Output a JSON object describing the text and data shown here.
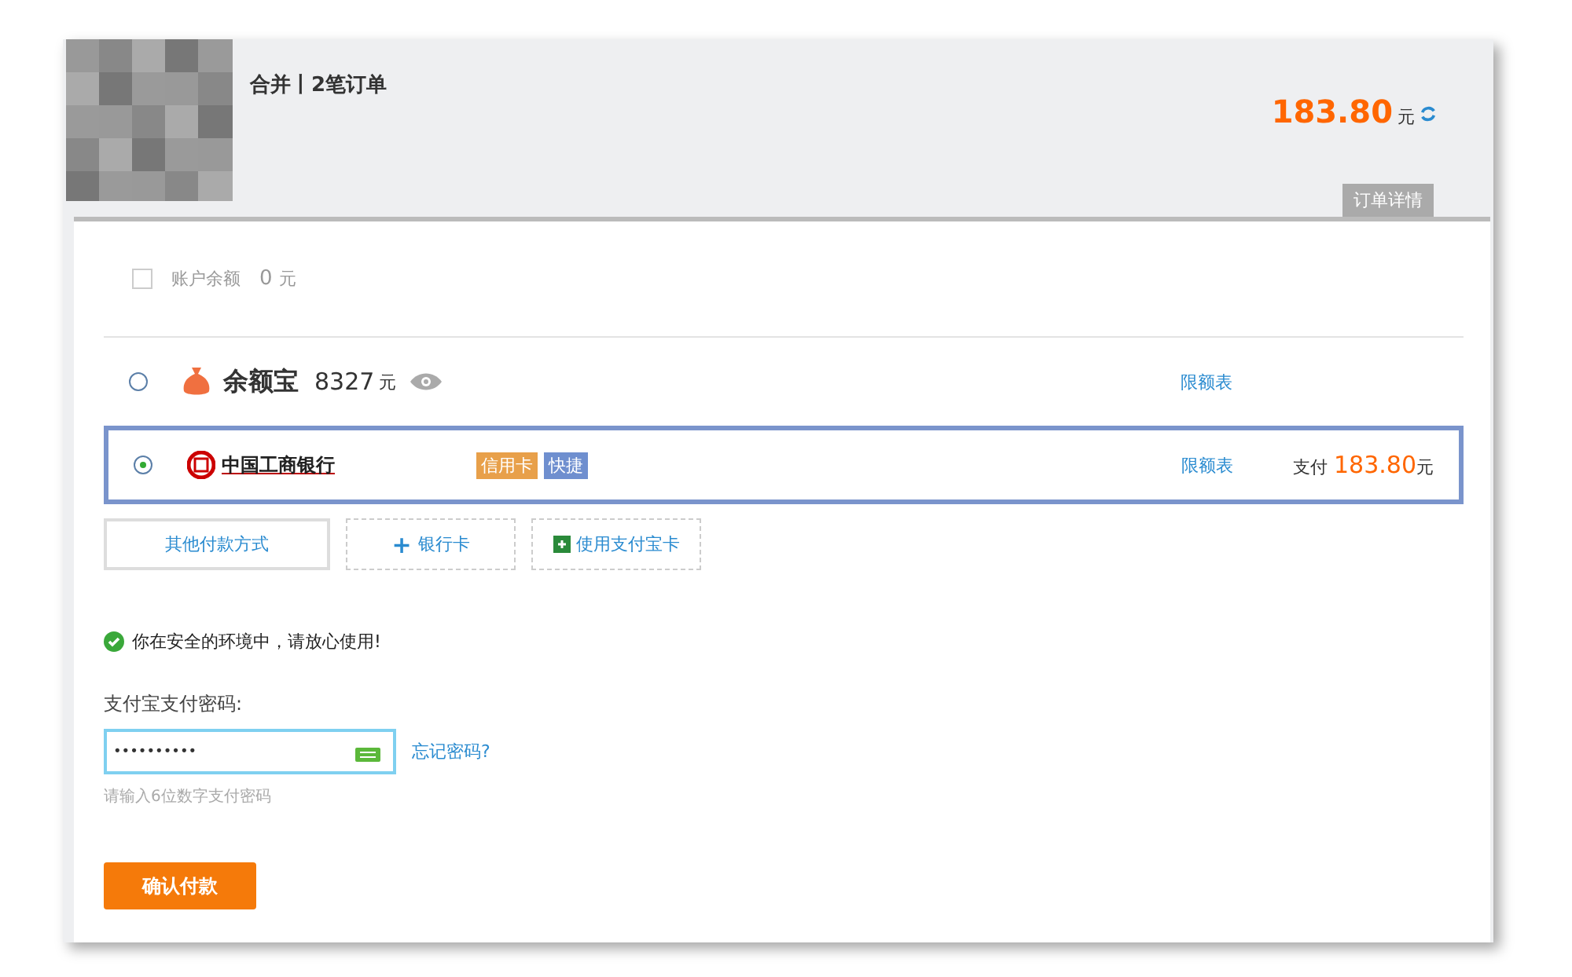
{
  "order": {
    "title": "合并丨2笔订单",
    "amount": "183.80",
    "unit": "元",
    "details_tab": "订单详情"
  },
  "balance": {
    "label": "账户余额",
    "amount": "0",
    "unit": "元",
    "checked": false
  },
  "methods": [
    {
      "kind": "yuebao",
      "selected": false,
      "name": "余额宝",
      "amount": "8327",
      "unit": "元",
      "limit_link": "限额表"
    },
    {
      "kind": "bank",
      "selected": true,
      "name": "中国工商银行",
      "tags": [
        {
          "text": "信用卡",
          "color": "#e8a04a"
        },
        {
          "text": "快捷",
          "color": "#6f8fcf"
        }
      ],
      "limit_link": "限额表",
      "pay_label": "支付",
      "pay_amount": "183.80",
      "pay_unit": "元"
    }
  ],
  "options": [
    {
      "kind": "other",
      "label": "其他付款方式"
    },
    {
      "kind": "add",
      "label": "银行卡",
      "icon": "+"
    },
    {
      "kind": "card",
      "label": "使用支付宝卡"
    }
  ],
  "security_note": "你在安全的环境中，请放心使用!",
  "password": {
    "label": "支付宝支付密码:",
    "value": "••••••••••",
    "forgot_link": "忘记密码?",
    "hint": "请输入6位数字支付密码"
  },
  "confirm_button": "确认付款"
}
